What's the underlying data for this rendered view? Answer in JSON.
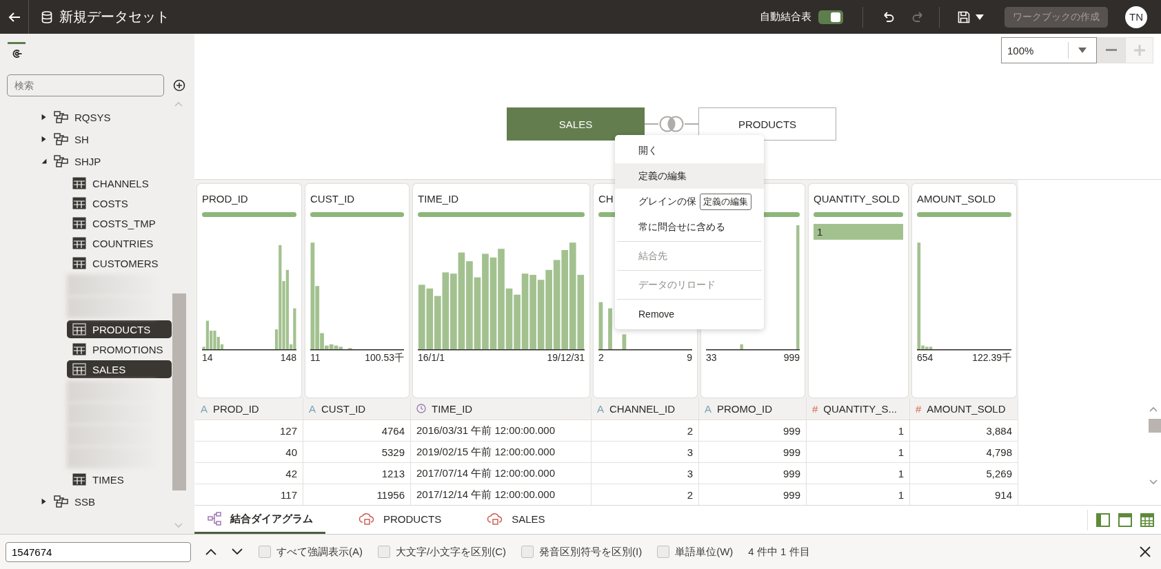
{
  "top_bar": {
    "title": "新規データセット",
    "auto_join": {
      "label": "自動結合表",
      "on": true
    },
    "actions": [
      {
        "kind": "undo",
        "disabled": false
      },
      {
        "kind": "redo",
        "disabled": true
      },
      {
        "kind": "save",
        "disabled": false
      }
    ],
    "create_button": {
      "label": "ワークブックの作成",
      "disabled": true
    },
    "avatar": "TN"
  },
  "sidebar": {
    "search": {
      "placeholder": "検索"
    },
    "tree": [
      {
        "kind": "schema",
        "label": "RQSYS",
        "expanded": false
      },
      {
        "kind": "schema",
        "label": "SH",
        "expanded": false
      },
      {
        "kind": "schema",
        "label": "SHJP",
        "expanded": true,
        "children": [
          {
            "kind": "table",
            "label": "CHANNELS",
            "selected": false
          },
          {
            "kind": "table",
            "label": "COSTS",
            "selected": false
          },
          {
            "kind": "table",
            "label": "COSTS_TMP",
            "selected": false
          },
          {
            "kind": "table",
            "label": "COUNTRIES",
            "selected": false
          },
          {
            "kind": "table",
            "label": "CUSTOMERS",
            "selected": false
          },
          {
            "kind": "blurred"
          },
          {
            "kind": "blurred"
          },
          {
            "kind": "table",
            "label": "PRODUCTS",
            "selected": true
          },
          {
            "kind": "table",
            "label": "PROMOTIONS",
            "selected": false
          },
          {
            "kind": "table",
            "label": "SALES",
            "selected": true
          },
          {
            "kind": "blurred"
          },
          {
            "kind": "blurred"
          },
          {
            "kind": "blurred"
          },
          {
            "kind": "blurred"
          },
          {
            "kind": "table",
            "label": "TIMES",
            "selected": false
          }
        ]
      },
      {
        "kind": "schema",
        "label": "SSB",
        "expanded": false
      }
    ]
  },
  "diagram": {
    "zoom": {
      "value": "100%",
      "minus_disabled": false,
      "plus_disabled": true
    },
    "nodes": [
      {
        "label": "SALES",
        "selected": true
      },
      {
        "label": "PRODUCTS",
        "selected": false
      }
    ]
  },
  "context_menu": {
    "items": [
      {
        "label": "開く",
        "selected": false,
        "disabled": false,
        "separator_before": false
      },
      {
        "label": "定義の編集",
        "selected": true,
        "disabled": false,
        "separator_before": false
      },
      {
        "label": "グレインの保",
        "selected": false,
        "disabled": false,
        "separator_before": false
      },
      {
        "label": "常に問合せに含める",
        "selected": false,
        "disabled": false,
        "separator_before": false
      },
      {
        "label": "結合先",
        "selected": false,
        "disabled": true,
        "separator_before": true
      },
      {
        "label": "データのリロード",
        "selected": false,
        "disabled": true,
        "separator_before": true
      },
      {
        "label": "Remove",
        "selected": false,
        "disabled": false,
        "separator_before": true
      }
    ],
    "tooltip": "定義の編集"
  },
  "profile_cards": [
    {
      "kind": "histogram",
      "title": "PROD_ID",
      "min": "14",
      "max": "148"
    },
    {
      "kind": "histogram",
      "title": "CUST_ID",
      "min": "11",
      "max": "100.53千"
    },
    {
      "kind": "histogram",
      "title": "TIME_ID",
      "min": "16/1/1",
      "max": "19/12/31"
    },
    {
      "kind": "histogram",
      "title": "CH",
      "min": "2",
      "max": "9"
    },
    {
      "kind": "histogram",
      "min": "33",
      "max": "999"
    },
    {
      "kind": "values",
      "title": "QUANTITY_SOLD",
      "values": [
        "1"
      ]
    },
    {
      "kind": "histogram",
      "title": "AMOUNT_SOLD",
      "min": "654",
      "max": "122.39千"
    }
  ],
  "table": {
    "columns": [
      {
        "kind": "text",
        "type_icon": "A",
        "name": "PROD_ID"
      },
      {
        "kind": "text",
        "type_icon": "A",
        "name": "CUST_ID"
      },
      {
        "kind": "date",
        "name": "TIME_ID"
      },
      {
        "kind": "text",
        "type_icon": "A",
        "name": "CHANNEL_ID"
      },
      {
        "kind": "text",
        "type_icon": "A",
        "name": "PROMO_ID"
      },
      {
        "kind": "number",
        "type_icon": "#",
        "name": "QUANTITY_S..."
      },
      {
        "kind": "number",
        "type_icon": "#",
        "name": "AMOUNT_SOLD"
      }
    ],
    "rows": [
      [
        "127",
        "4764",
        "2016/03/31 午前 12:00:00.000",
        "2",
        "999",
        "1",
        "3,884"
      ],
      [
        "40",
        "5329",
        "2019/02/15 午前 12:00:00.000",
        "3",
        "999",
        "1",
        "4,798"
      ],
      [
        "42",
        "1213",
        "2017/07/14 午前 12:00:00.000",
        "3",
        "999",
        "1",
        "5,269"
      ],
      [
        "117",
        "11956",
        "2017/12/14 午前 12:00:00.000",
        "2",
        "999",
        "1",
        "914"
      ]
    ]
  },
  "bottom_tabs": [
    {
      "kind": "diagram",
      "label": "結合ダイアグラム",
      "selected": true
    },
    {
      "kind": "source",
      "label": "PRODUCTS",
      "selected": false
    },
    {
      "kind": "source",
      "label": "SALES",
      "selected": false
    }
  ],
  "find_bar": {
    "value": "1547674",
    "options": [
      {
        "label": "すべて強調表示(A)",
        "checked": false
      },
      {
        "label": "大文字/小文字を区別(C)",
        "checked": false
      },
      {
        "label": "発音区別符号を区別(I)",
        "checked": false
      },
      {
        "label": "単語単位(W)",
        "checked": false
      }
    ],
    "count": "4 件中 1 件目"
  }
}
